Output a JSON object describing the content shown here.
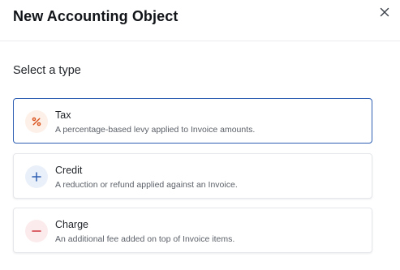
{
  "dialog": {
    "title": "New Accounting Object",
    "close_icon": "close-icon"
  },
  "section": {
    "label": "Select a type"
  },
  "options": [
    {
      "title": "Tax",
      "description": "A percentage-based levy applied to Invoice amounts.",
      "icon": "percent-icon",
      "icon_color": "#d9541e",
      "icon_bg": "#fdf0e8",
      "selected": true
    },
    {
      "title": "Credit",
      "description": "A reduction or refund applied against an Invoice.",
      "icon": "plus-icon",
      "icon_color": "#2f5fb3",
      "icon_bg": "#eaf0fa",
      "selected": false
    },
    {
      "title": "Charge",
      "description": "An additional fee added on top of Invoice items.",
      "icon": "minus-icon",
      "icon_color": "#d0383e",
      "icon_bg": "#fcebec",
      "selected": false
    }
  ],
  "colors": {
    "selected_border": "#2f5fb3"
  }
}
